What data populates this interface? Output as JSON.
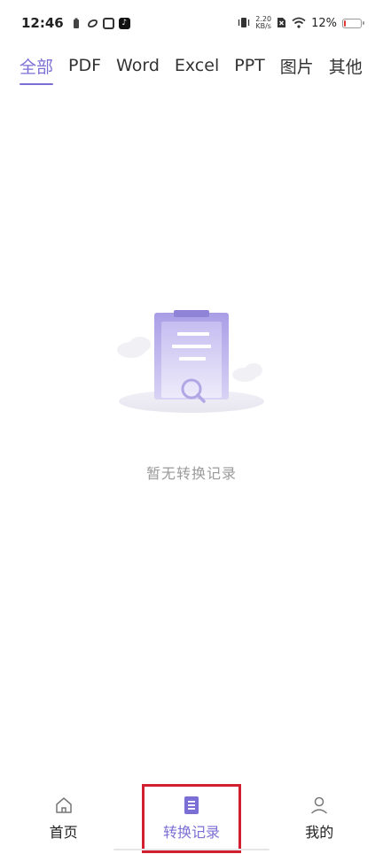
{
  "status_bar": {
    "time": "12:46",
    "net_speed_value": "2.20",
    "net_speed_unit": "KB/s",
    "battery_percent": "12%",
    "battery_level": 0.12,
    "battery_color": "#e53935"
  },
  "tabs": [
    {
      "label": "全部",
      "active": true
    },
    {
      "label": "PDF",
      "active": false
    },
    {
      "label": "Word",
      "active": false
    },
    {
      "label": "Excel",
      "active": false
    },
    {
      "label": "PPT",
      "active": false
    },
    {
      "label": "图片",
      "active": false
    },
    {
      "label": "其他",
      "active": false
    }
  ],
  "empty_state": {
    "message": "暂无转换记录",
    "icon": "clipboard-search-icon"
  },
  "bottom_nav": {
    "items": [
      {
        "label": "首页",
        "icon": "home-icon",
        "active": false
      },
      {
        "label": "转换记录",
        "icon": "document-icon",
        "active": true
      },
      {
        "label": "我的",
        "icon": "user-icon",
        "active": false
      }
    ]
  },
  "colors": {
    "accent": "#7b6fd6",
    "highlight_border": "#d32030",
    "muted_text": "#9a9a9a"
  }
}
